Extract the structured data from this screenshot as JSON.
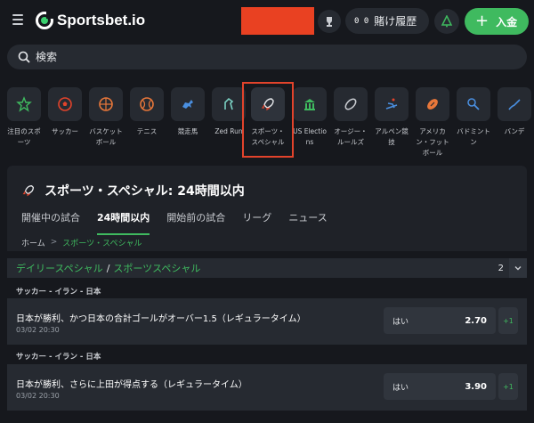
{
  "topbar": {
    "brand": "Sportsbet.io",
    "history_label": "賭け履歴",
    "history_glyph": "0 0",
    "deposit_label": "入金",
    "deposit_plus": "+"
  },
  "search": {
    "placeholder": "検索"
  },
  "categories": [
    {
      "label": "注目のスポーツ",
      "icon": "star-icon"
    },
    {
      "label": "サッカー",
      "icon": "soccer-ball-icon"
    },
    {
      "label": "バスケットボール",
      "icon": "basketball-icon"
    },
    {
      "label": "テニス",
      "icon": "tennis-ball-icon"
    },
    {
      "label": "競走馬",
      "icon": "horse-racing-icon"
    },
    {
      "label": "Zed Run",
      "icon": "zed-run-icon"
    },
    {
      "label": "スポーツ・スペシャル",
      "icon": "rocket-icon"
    },
    {
      "label": "US Elections",
      "icon": "capitol-icon"
    },
    {
      "label": "オージー・ルールズ",
      "icon": "aussie-rules-ball-icon"
    },
    {
      "label": "アルペン競技",
      "icon": "skier-icon"
    },
    {
      "label": "アメリカン・フットボール",
      "icon": "american-football-icon"
    },
    {
      "label": "バドミントン",
      "icon": "badminton-icon"
    },
    {
      "label": "バンデ",
      "icon": "bandy-icon"
    }
  ],
  "panel": {
    "title": "スポーツ・スペシャル: 24時間以内",
    "tabs": [
      "開催中の試合",
      "24時間以内",
      "開始前の試合",
      "リーグ",
      "ニュース"
    ]
  },
  "breadcrumb": {
    "home": "ホーム",
    "sep": ">",
    "current": "スポーツ・スペシャル"
  },
  "section": {
    "daily": "デイリースペシャル",
    "slash": "/",
    "sport": "スポーツスペシャル",
    "count": "2"
  },
  "markets": [
    {
      "league": "サッカー - イラン - 日本",
      "name": "日本が勝利、かつ日本の合計ゴールがオーバー1.5（レギュラータイム）",
      "date": "03/02 20:30",
      "selection": "はい",
      "price": "2.70",
      "more": "+1"
    },
    {
      "league": "サッカー - イラン - 日本",
      "name": "日本が勝利、さらに上田が得点する（レギュラータイム）",
      "date": "03/02 20:30",
      "selection": "はい",
      "price": "3.90",
      "more": "+1"
    }
  ],
  "colors": {
    "accent": "#3fba5f",
    "highlight": "#e2432b",
    "redacted": "#e94122"
  }
}
